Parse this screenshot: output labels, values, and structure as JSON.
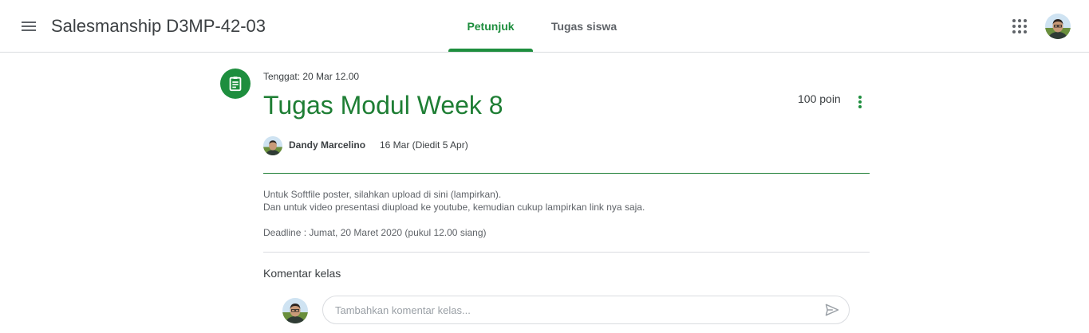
{
  "header": {
    "class_title": "Salesmanship D3MP-42-03",
    "tabs": [
      {
        "label": "Petunjuk",
        "active": true
      },
      {
        "label": "Tugas siswa",
        "active": false
      }
    ]
  },
  "assignment": {
    "due": "Tenggat: 20 Mar 12.00",
    "title": "Tugas Modul Week 8",
    "points": "100 poin",
    "author": "Dandy Marcelino",
    "date": "16 Mar (Diedit 5 Apr)",
    "description": {
      "line1": "Untuk Softfile poster, silahkan upload di sini (lampirkan).",
      "line2": "Dan untuk video presentasi diupload ke youtube, kemudian cukup lampirkan link nya saja.",
      "line3": "Deadline : Jumat, 20 Maret 2020 (pukul 12.00 siang)"
    }
  },
  "comments": {
    "heading": "Komentar kelas",
    "placeholder": "Tambahkan komentar kelas..."
  },
  "icons": {
    "menu": "menu-icon",
    "apps": "apps-grid-icon",
    "assignment": "assignment-clipboard-icon",
    "more": "more-vertical-icon",
    "send": "send-icon"
  },
  "colors": {
    "accent": "#1e8e3e",
    "title_green": "#1e7e34",
    "divider": "#dadce0"
  }
}
